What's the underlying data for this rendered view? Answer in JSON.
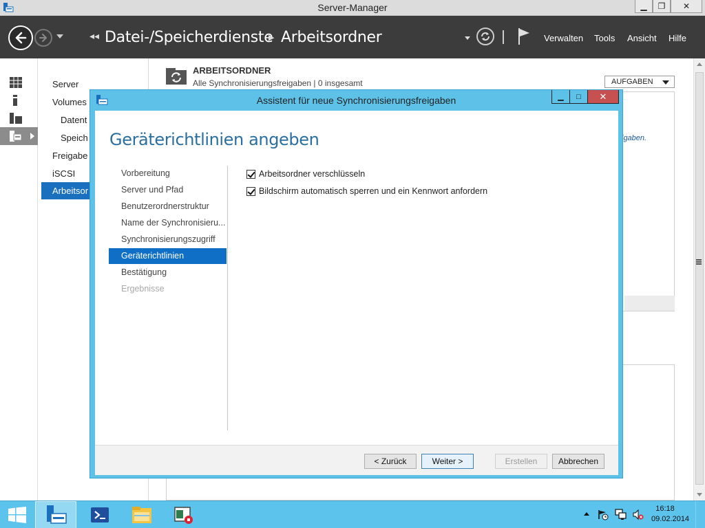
{
  "window": {
    "title": "Server-Manager",
    "controls": {
      "minimize": "▁",
      "maximize": "❐",
      "close": "✕"
    }
  },
  "header": {
    "breadcrumb": [
      "Datei-/Speicherdienste",
      "Arbeitsordner"
    ],
    "menu": [
      "Verwalten",
      "Tools",
      "Ansicht",
      "Hilfe"
    ]
  },
  "rail": {
    "items": [
      {
        "icon": "dashboard-icon"
      },
      {
        "icon": "local-server-icon"
      },
      {
        "icon": "all-servers-icon"
      },
      {
        "icon": "file-storage-icon",
        "active": true
      }
    ]
  },
  "nav": {
    "items": [
      {
        "label": "Server",
        "level": 0
      },
      {
        "label": "Volumes",
        "level": 0
      },
      {
        "label": "Datent",
        "level": 1
      },
      {
        "label": "Speich",
        "level": 1
      },
      {
        "label": "Freigabe",
        "level": 0
      },
      {
        "label": "iSCSI",
        "level": 0
      },
      {
        "label": "Arbeitsor",
        "level": 0,
        "active": true
      }
    ]
  },
  "main": {
    "section_title": "ARBEITSORDNER",
    "section_subtitle": "Alle Synchronisierungsfreigaben | 0 insgesamt",
    "tasks_label": "AUFGABEN",
    "bg_link_fragment": "igaben."
  },
  "dialog": {
    "title": "Assistent für neue Synchronisierungsfreigaben",
    "heading": "Geräterichtlinien angeben",
    "steps": [
      {
        "label": "Vorbereitung",
        "state": "normal"
      },
      {
        "label": "Server und Pfad",
        "state": "normal"
      },
      {
        "label": "Benutzerordnerstruktur",
        "state": "normal"
      },
      {
        "label": "Name der Synchronisieru...",
        "state": "normal"
      },
      {
        "label": "Synchronisierungszugriff",
        "state": "normal"
      },
      {
        "label": "Geräterichtlinien",
        "state": "active"
      },
      {
        "label": "Bestätigung",
        "state": "normal"
      },
      {
        "label": "Ergebnisse",
        "state": "disabled"
      }
    ],
    "options": [
      {
        "label": "Arbeitsordner verschlüsseln",
        "checked": true
      },
      {
        "label": "Bildschirm automatisch sperren und ein Kennwort anfordern",
        "checked": true
      }
    ],
    "buttons": {
      "back": "< Zurück",
      "next": "Weiter >",
      "create": "Erstellen",
      "cancel": "Abbrechen"
    },
    "window_controls": {
      "minimize": "▁",
      "maximize": "□",
      "close": "✕"
    }
  },
  "taskbar": {
    "time": "16:18",
    "date": "09.02.2014",
    "apps": [
      "server-manager-icon",
      "powershell-icon",
      "file-explorer-icon",
      "stop-app-icon"
    ]
  },
  "colors": {
    "header_bg": "#3c3c3c",
    "dialog_frame": "#5dc1e8",
    "accent": "#1a6fbf",
    "close_red": "#c75050",
    "taskbar": "#5bc3ec"
  }
}
